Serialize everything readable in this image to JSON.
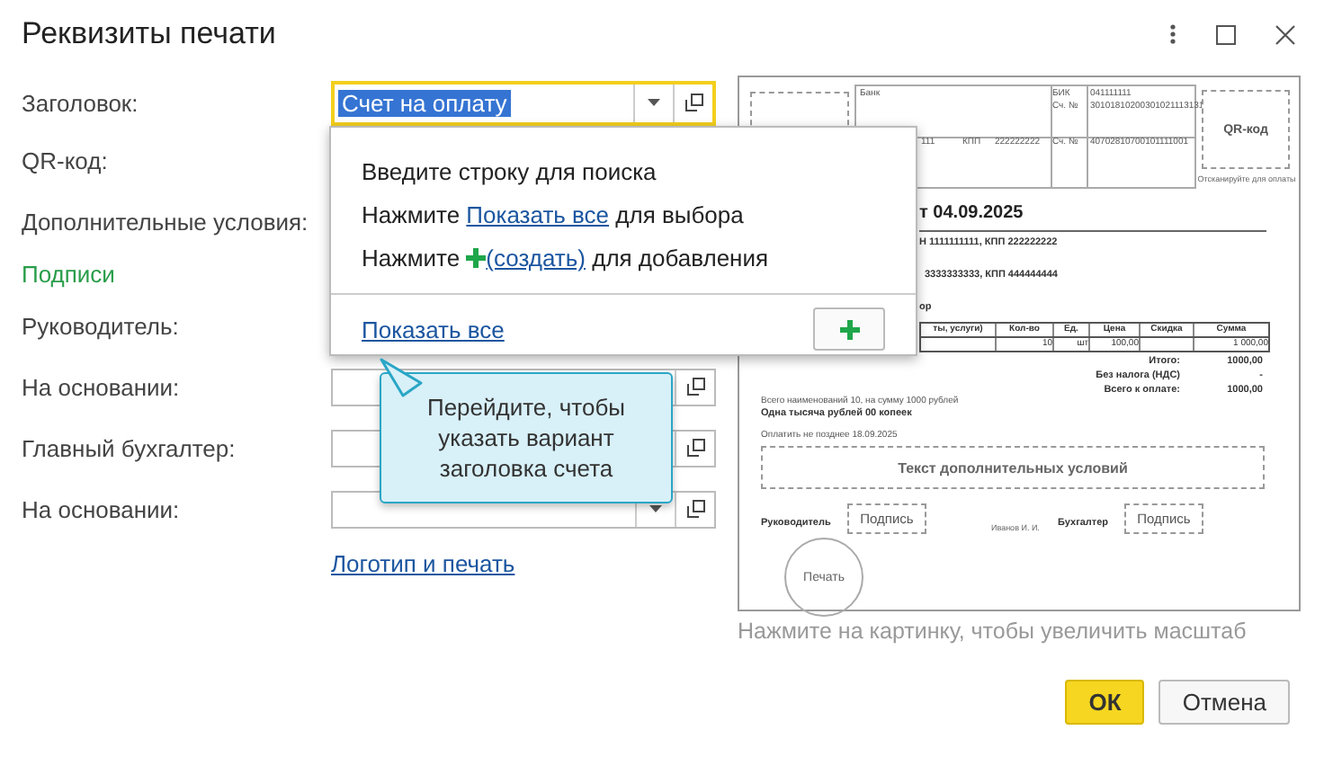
{
  "window": {
    "title": "Реквизиты печати"
  },
  "form": {
    "rows": [
      {
        "label": "Заголовок:",
        "field": {
          "value": "Счет на оплату",
          "focused": true,
          "dropdown": true
        }
      },
      {
        "label": "QR-код:"
      },
      {
        "label": "Дополнительные условия:"
      },
      {
        "section": "Подписи"
      },
      {
        "label": "Руководитель:"
      },
      {
        "label": "На основании:",
        "field": {
          "focused": false,
          "dropdown": false
        }
      },
      {
        "label": "Главный бухгалтер:",
        "field": {
          "focused": false,
          "dropdown": false
        }
      },
      {
        "label": "На основании:",
        "field": {
          "focused": false,
          "dropdown": true
        }
      }
    ],
    "link": "Логотип и печать"
  },
  "popup": {
    "lines": [
      {
        "kind": "text",
        "text": "Введите строку для поиска"
      },
      {
        "kind": "link",
        "before": "Нажмите ",
        "link": "Показать все",
        "after": " для выбора"
      },
      {
        "kind": "create",
        "before": "Нажмите ",
        "link": "(создать)",
        "after": " для добавления"
      }
    ],
    "show_all": "Показать все"
  },
  "tooltip": {
    "text": "Перейдите, чтобы указать вариант заголовка счета"
  },
  "preview": {
    "bank": "Банк",
    "bik_label": "БИК",
    "bik": "041111111",
    "acc_label": "Сч. №",
    "acc": "30101810200301021113131",
    "inn_tail": "111",
    "kpp_label": "КПП",
    "kpp": "222222222",
    "acc2_label": "Сч. №",
    "acc2": "40702810700101111001",
    "qr": "QR-код",
    "qr_hint": "Отсканируйте для оплаты",
    "title": "т 04.09.2025",
    "seller": "Н 1111111111, КПП 222222222",
    "buyer": "3333333333, КПП 444444444",
    "basis": "ор",
    "columns": [
      "ты, услуги)",
      "Кол-во",
      "Ед.",
      "Цена",
      "Скидка",
      "Сумма"
    ],
    "row": {
      "quantity": "10",
      "unit": "шт",
      "price": "100,00",
      "sum": "1 000,00"
    },
    "totals": [
      {
        "label": "Итого:",
        "value": "1000,00"
      },
      {
        "label": "Без налога (НДС)",
        "value": "-"
      },
      {
        "label": "Всего к оплате:",
        "value": "1000,00"
      }
    ],
    "count_line": "Всего наименований 10, на сумму 1000 рублей",
    "sum_words": "Одна тысяча рублей 00 копеек",
    "due": "Оплатить не позднее 18.09.2025",
    "terms": "Текст дополнительных условий",
    "head_label": "Руководитель",
    "sign1": "Подпись",
    "head_name": "Иванов И. И.",
    "acc_label2": "Бухгалтер",
    "sign2": "Подпись",
    "stamp": "Печать"
  },
  "caption": "Нажмите на картинку, чтобы увеличить масштаб",
  "buttons": [
    {
      "label": "ОК",
      "primary": true
    },
    {
      "label": "Отмена",
      "primary": false
    }
  ]
}
